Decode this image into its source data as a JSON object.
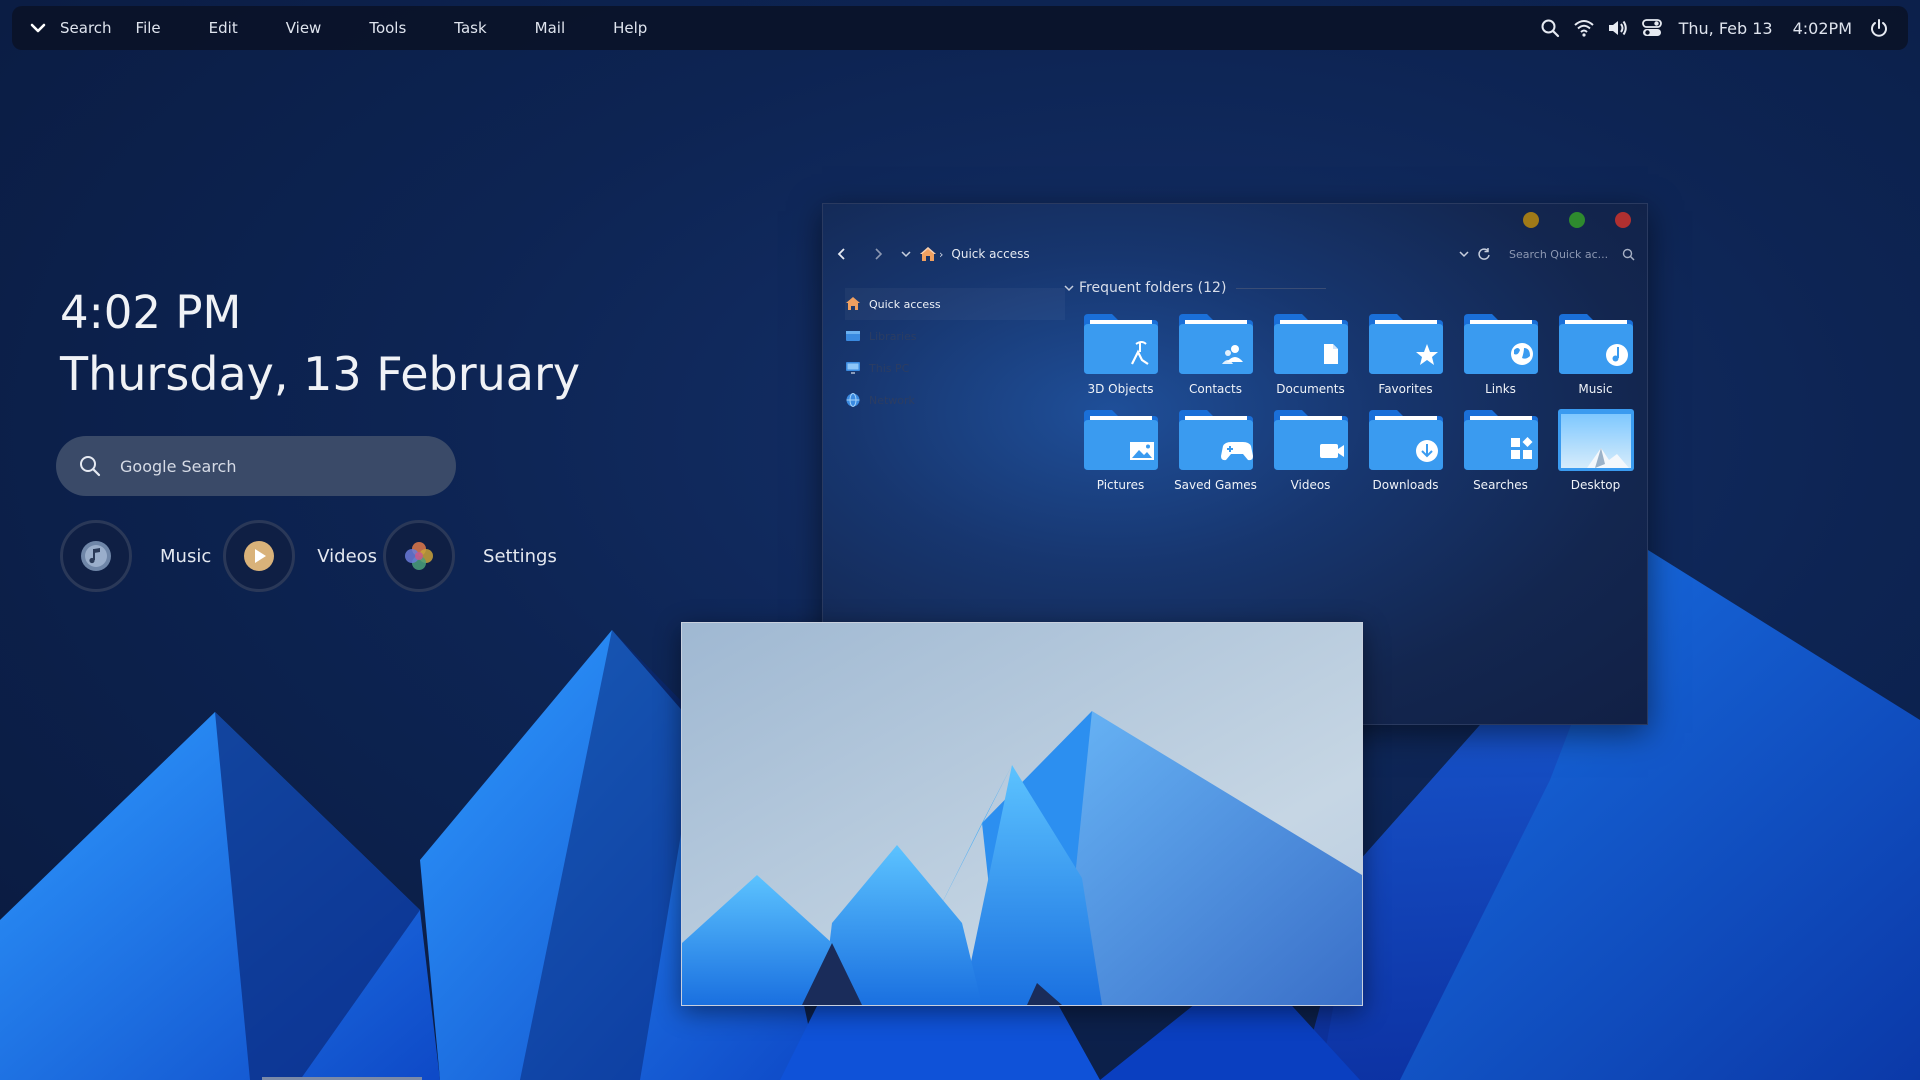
{
  "topbar": {
    "menu": [
      "Search",
      "File",
      "Edit",
      "View",
      "Tools",
      "Task",
      "Mail",
      "Help"
    ],
    "date": "Thu, Feb 13",
    "time": "4:02PM",
    "icons": [
      "chevron-down-icon",
      "search-icon",
      "wifi-icon",
      "volume-icon",
      "control-center-icon",
      "power-icon"
    ]
  },
  "widget": {
    "time": "4:02 PM",
    "date": "Thursday, 13 February",
    "search_placeholder": "Google Search",
    "launchers": [
      {
        "label": "Music",
        "icon": "music-note-icon"
      },
      {
        "label": "Videos",
        "icon": "play-icon"
      },
      {
        "label": "Settings",
        "icon": "petals-icon"
      }
    ]
  },
  "explorer": {
    "breadcrumb": "Quick access",
    "search_placeholder": "Search Quick ac...",
    "sidebar": [
      "Quick access",
      "Libraries",
      "This PC",
      "Network"
    ],
    "section_title": "Frequent folders (12)",
    "folders": [
      {
        "label": "3D Objects",
        "icon": "3d-objects-icon"
      },
      {
        "label": "Contacts",
        "icon": "contacts-icon"
      },
      {
        "label": "Documents",
        "icon": "document-icon"
      },
      {
        "label": "Favorites",
        "icon": "star-icon"
      },
      {
        "label": "Links",
        "icon": "globe-icon"
      },
      {
        "label": "Music",
        "icon": "music-icon"
      },
      {
        "label": "Pictures",
        "icon": "picture-icon"
      },
      {
        "label": "Saved Games",
        "icon": "gamepad-icon"
      },
      {
        "label": "Videos",
        "icon": "video-camera-icon"
      },
      {
        "label": "Downloads",
        "icon": "download-icon"
      },
      {
        "label": "Searches",
        "icon": "searches-icon"
      },
      {
        "label": "Desktop",
        "icon": "desktop-thumbnail-icon"
      }
    ],
    "traffic_colors": [
      "#a07a18",
      "#2e8a2e",
      "#b03030"
    ]
  },
  "colors": {
    "accent_blue": "#2a8cf0",
    "folder_blue": "#3a9bf0",
    "background": "#0d2453"
  }
}
